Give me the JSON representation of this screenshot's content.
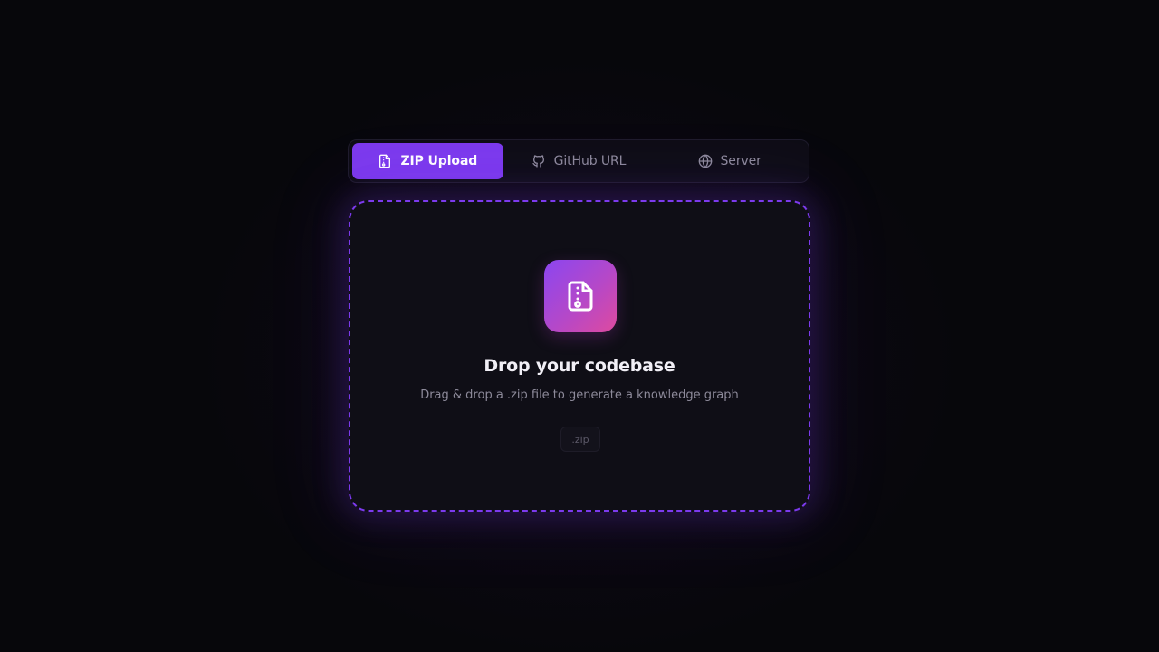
{
  "tabs": [
    {
      "label": "ZIP Upload",
      "icon": "file-archive-icon",
      "active": true
    },
    {
      "label": "GitHub URL",
      "icon": "github-icon",
      "active": false
    },
    {
      "label": "Server",
      "icon": "globe-icon",
      "active": false
    }
  ],
  "dropzone": {
    "icon": "file-archive-icon",
    "title": "Drop your codebase",
    "subtitle": "Drag & drop a .zip file to generate a knowledge graph",
    "accepted_extension": ".zip"
  },
  "colors": {
    "accent": "#7c3aed",
    "gradient_start": "#8b46f0",
    "gradient_end": "#de4a9f",
    "background": "#07070b"
  }
}
